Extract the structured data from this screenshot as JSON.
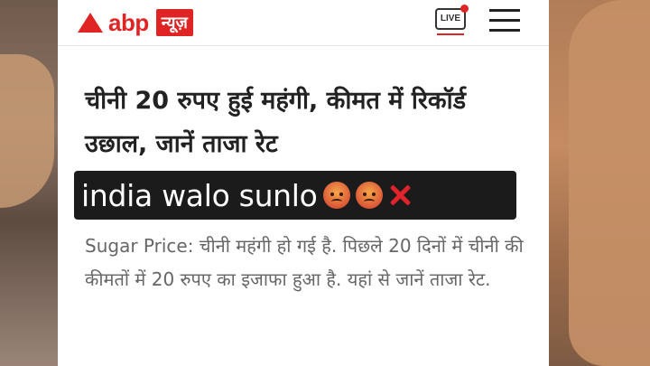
{
  "header": {
    "logo_text": "abp",
    "logo_badge": "न्यूज़",
    "live_label": "LIVE",
    "menu_icon": "hamburger-menu-icon"
  },
  "article": {
    "headline": "चीनी 20 रुपए हुई महंगी, कीमत में रिकॉर्ड उछाल, जानें ताजा रेट",
    "summary": "Sugar Price: चीनी महंगी हो गई है. पिछले 20 दिनों में चीनी की कीमतों में 20 रुपए का इजाफा हुआ है. यहां से जानें ताजा रेट."
  },
  "caption": {
    "text": "india walo sunlo",
    "emojis": [
      "angry-face-icon",
      "angry-face-icon",
      "cross-mark-icon"
    ]
  },
  "colors": {
    "brand_red": "#e02424",
    "headline": "#222222",
    "summary": "#666666",
    "caption_bg": "#1b1b1b"
  }
}
